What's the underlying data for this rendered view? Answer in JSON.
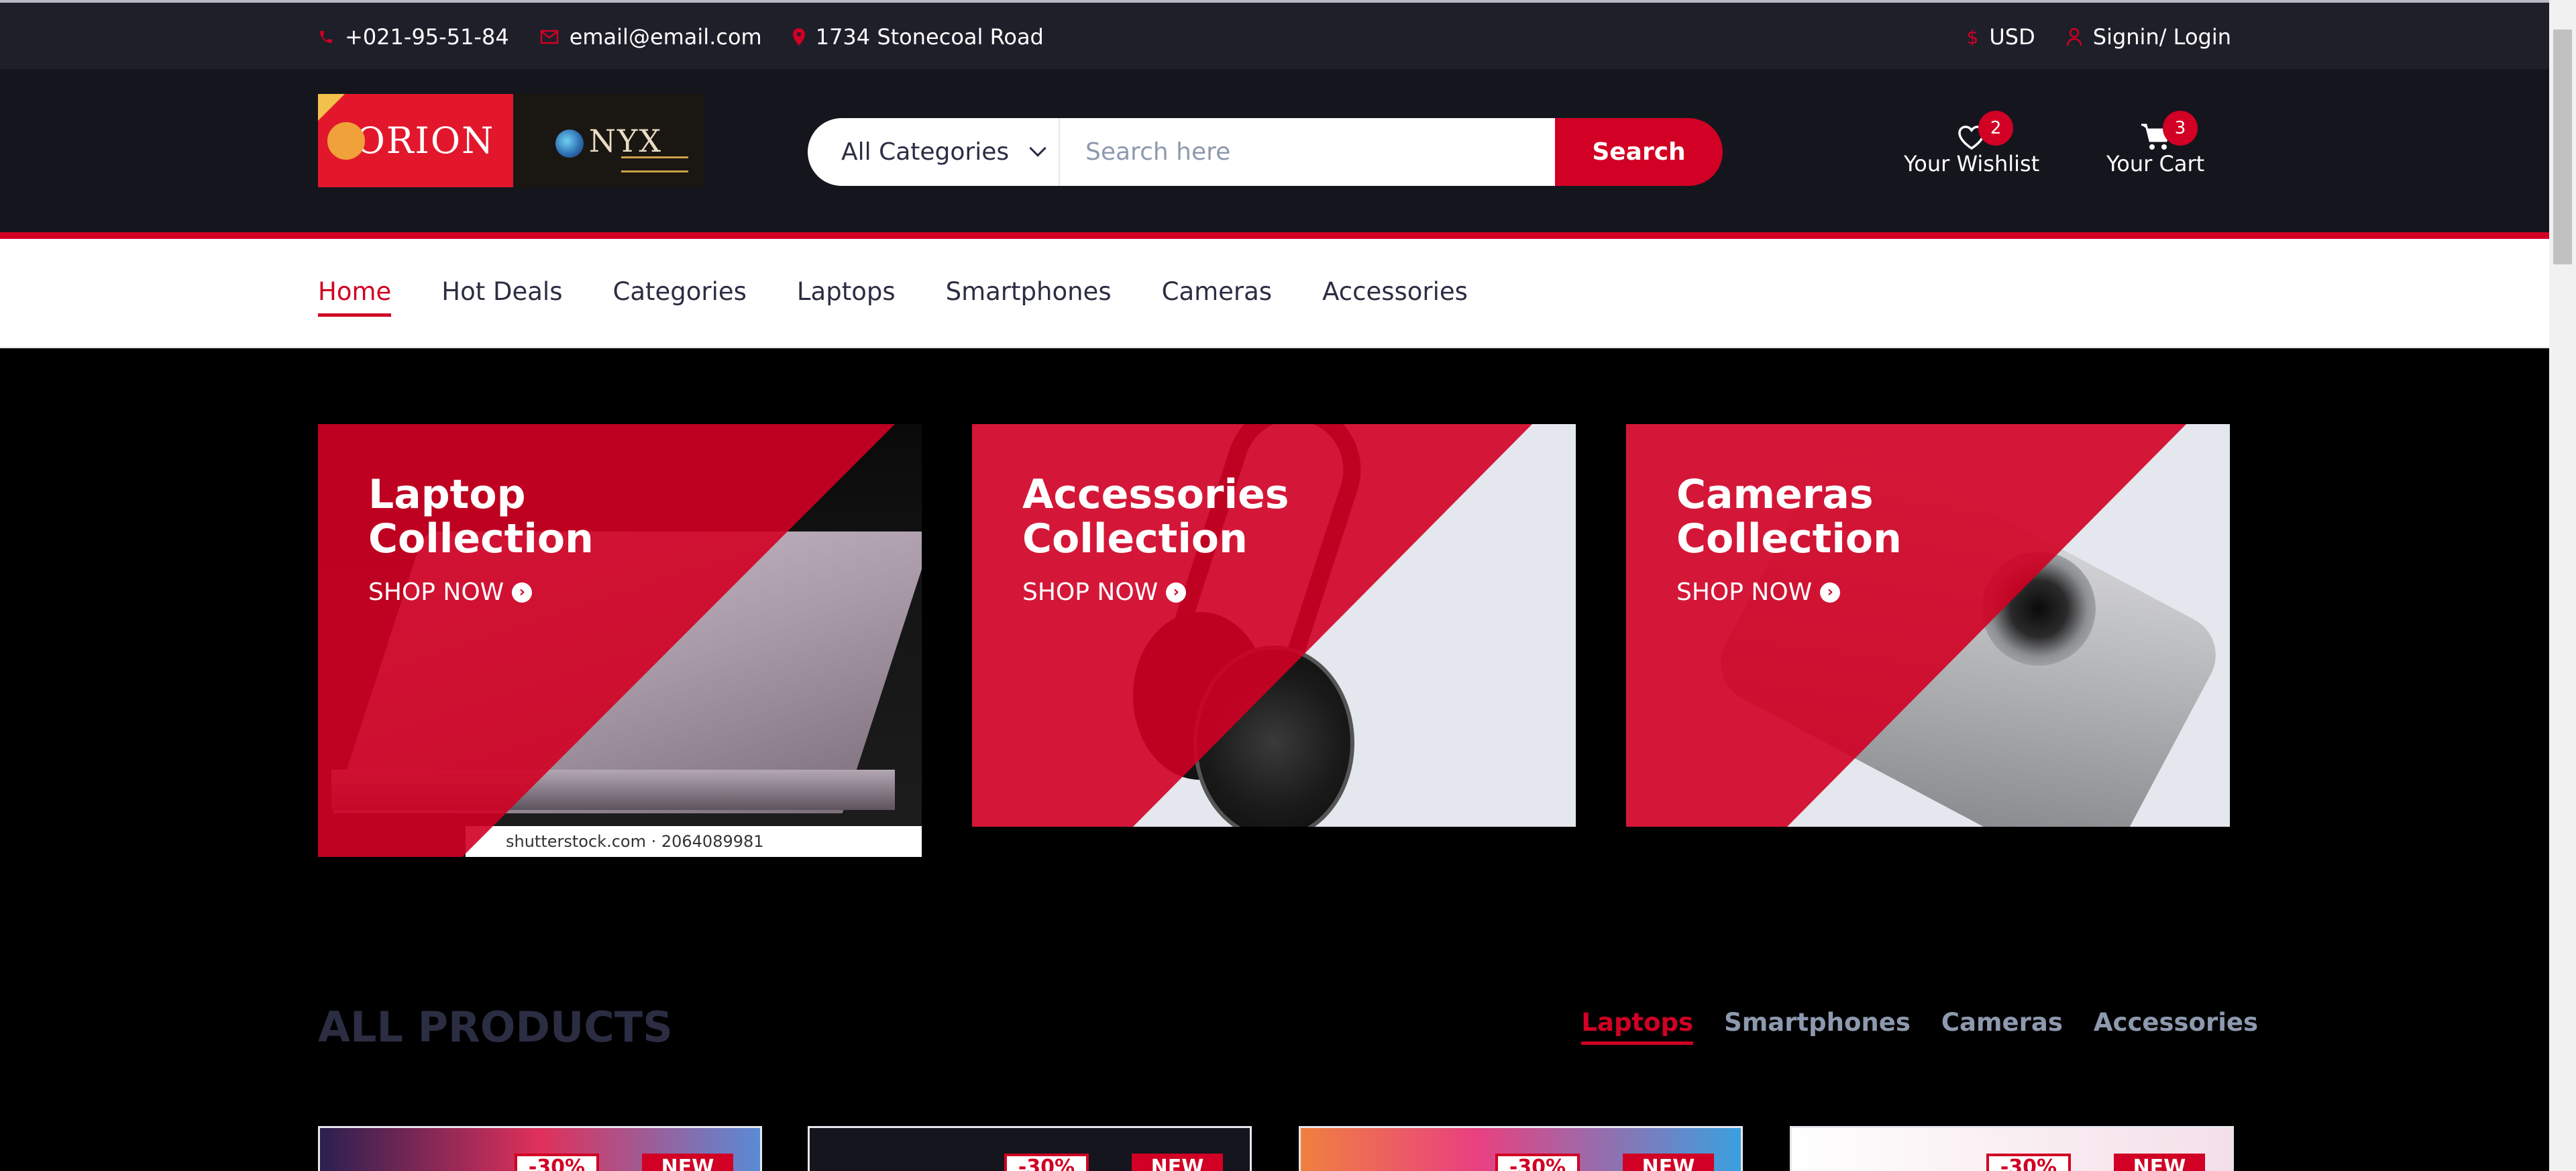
{
  "topbar": {
    "phone": "+021-95-51-84",
    "email": "email@email.com",
    "address": "1734 Stonecoal Road",
    "currency": "USD",
    "login": "Signin/ Login"
  },
  "logo": {
    "brand_left": "ORION",
    "brand_right": "NYX"
  },
  "search": {
    "category": "All Categories",
    "placeholder": "Search here",
    "button": "Search"
  },
  "header": {
    "wishlist_label": "Your Wishlist",
    "wishlist_qty": "2",
    "cart_label": "Your Cart",
    "cart_qty": "3"
  },
  "nav": {
    "items": [
      "Home",
      "Hot Deals",
      "Categories",
      "Laptops",
      "Smartphones",
      "Cameras",
      "Accessories"
    ],
    "active": "Home"
  },
  "collections": [
    {
      "title_line1": "Laptop",
      "title_line2": "Collection",
      "cta": "SHOP NOW",
      "watermark": "shutterstock.com · 2064089981"
    },
    {
      "title_line1": "Accessories",
      "title_line2": "Collection",
      "cta": "SHOP NOW"
    },
    {
      "title_line1": "Cameras",
      "title_line2": "Collection",
      "cta": "SHOP NOW"
    }
  ],
  "products": {
    "title": "ALL PRODUCTS",
    "tabs": [
      "Laptops",
      "Smartphones",
      "Cameras",
      "Accessories"
    ],
    "active_tab": "Laptops",
    "cards": [
      {
        "sale": "-30%",
        "badge": "NEW"
      },
      {
        "sale": "-30%",
        "badge": "NEW"
      },
      {
        "sale": "-30%",
        "badge": "NEW"
      },
      {
        "sale": "-30%",
        "badge": "NEW"
      }
    ]
  },
  "colors": {
    "primary": "#D10024",
    "dark": "#15161D",
    "topbar": "#1E1F29",
    "text": "#2B2D42"
  },
  "icons": {
    "phone": "phone-icon",
    "email": "envelope-icon",
    "address": "map-marker-icon",
    "currency": "dollar-icon",
    "login": "user-icon",
    "wishlist": "heart-icon",
    "cart": "shopping-cart-icon",
    "shop_now": "arrow-circle-right-icon"
  }
}
